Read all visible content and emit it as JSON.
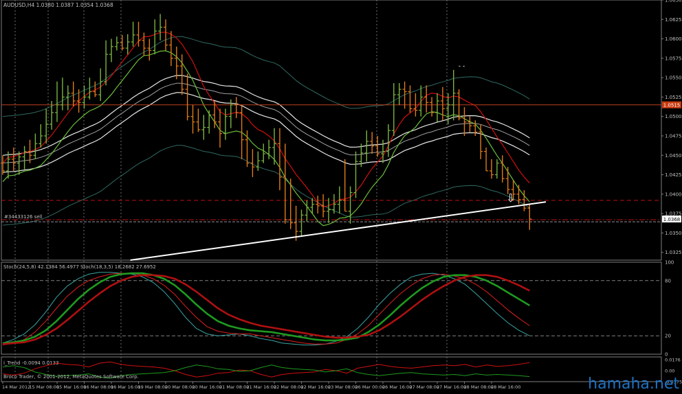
{
  "colors": {
    "background": "#000000",
    "frame": "#808080",
    "grid": "#707070",
    "axis_text": "#c0c0c0",
    "bull": "#7cb342",
    "bear": "#e07a1a",
    "red_ma": "#d01010",
    "green_ma": "#6abf3a",
    "envelope_outer": "#e8e8e8",
    "envelope_inner": "#a0a0a0",
    "outer_band": "#2f6a62",
    "trendline": "#ffffff",
    "level_line": "#c04020",
    "dash_level": "#c01010",
    "bid_line": "#909090",
    "price_tag_bg": "#c83a10",
    "price_tag_text": "#ffffff",
    "watermark": "#1f72c4",
    "stoch_cyan": "#3aa3a3",
    "stoch_green": "#1f9a1f",
    "stoch_red": "#b01010",
    "stoch_lightred": "#e02020",
    "trend_green": "#1f9a1f",
    "trend_red": "#d01010"
  },
  "chart_data": [
    {
      "type": "ohlc",
      "title": "AUDUSD,H4  1.0380 1.0387 1.0354 1.0368",
      "price_axis": {
        "ylim": [
          1.0315,
          1.065
        ],
        "ticks": [
          "1.0650",
          "1.0625",
          "1.0600",
          "1.0575",
          "1.0550",
          "1.0525",
          "1.0500",
          "1.0475",
          "1.0450",
          "1.0425",
          "1.0400",
          "1.0375",
          "1.0350",
          "1.0325"
        ]
      },
      "bars": {
        "open": [
          1.044,
          1.043,
          1.0445,
          1.044,
          1.0448,
          1.0455,
          1.045,
          1.0465,
          1.0475,
          1.049,
          1.0505,
          1.0515,
          1.0525,
          1.053,
          1.052,
          1.0518,
          1.0525,
          1.0532,
          1.0528,
          1.0545,
          1.058,
          1.059,
          1.0595,
          1.0588,
          1.0596,
          1.0605,
          1.0598,
          1.0588,
          1.0585,
          1.061,
          1.0615,
          1.0592,
          1.0575,
          1.0565,
          1.0535,
          1.05,
          1.0493,
          1.0483,
          1.0486,
          1.0502,
          1.0493,
          1.0478,
          1.05,
          1.0515,
          1.0505,
          1.047,
          1.044,
          1.0435,
          1.0443,
          1.0452,
          1.046,
          1.0465,
          1.0422,
          1.0367,
          1.0363,
          1.0352,
          1.0373,
          1.0383,
          1.0387,
          1.0385,
          1.0378,
          1.038,
          1.0387,
          1.0392,
          1.0378,
          1.0402,
          1.0442,
          1.0453,
          1.0468,
          1.0462,
          1.0452,
          1.0455,
          1.0482,
          1.0528,
          1.0535,
          1.0532,
          1.051,
          1.0508,
          1.0525,
          1.0518,
          1.0505,
          1.052,
          1.051,
          1.0515,
          1.053,
          1.0498,
          1.0493,
          1.0488,
          1.048,
          1.0455,
          1.043,
          1.0425,
          1.044,
          1.042,
          1.0406,
          1.04,
          1.0393,
          1.0382
        ],
        "high": [
          1.045,
          1.0455,
          1.046,
          1.0455,
          1.0462,
          1.047,
          1.0478,
          1.049,
          1.051,
          1.052,
          1.0545,
          1.055,
          1.054,
          1.0545,
          1.0535,
          1.054,
          1.055,
          1.0545,
          1.0562,
          1.0598,
          1.06,
          1.0603,
          1.0605,
          1.0606,
          1.0622,
          1.0622,
          1.0608,
          1.06,
          1.0625,
          1.0632,
          1.0625,
          1.061,
          1.059,
          1.058,
          1.0555,
          1.0515,
          1.051,
          1.0502,
          1.0508,
          1.052,
          1.051,
          1.051,
          1.0522,
          1.0525,
          1.0515,
          1.0482,
          1.0458,
          1.0455,
          1.0465,
          1.047,
          1.0485,
          1.0485,
          1.0465,
          1.042,
          1.0385,
          1.038,
          1.0392,
          1.0395,
          1.0398,
          1.04,
          1.0395,
          1.04,
          1.041,
          1.0445,
          1.041,
          1.0455,
          1.0465,
          1.0482,
          1.048,
          1.0475,
          1.047,
          1.049,
          1.0543,
          1.0543,
          1.0545,
          1.054,
          1.053,
          1.054,
          1.054,
          1.0525,
          1.053,
          1.0538,
          1.053,
          1.056,
          1.0535,
          1.0512,
          1.05,
          1.0495,
          1.049,
          1.046,
          1.0445,
          1.0445,
          1.045,
          1.0435,
          1.0418,
          1.0412,
          1.0405,
          1.0387
        ],
        "low": [
          1.0425,
          1.042,
          1.043,
          1.0425,
          1.0432,
          1.044,
          1.0445,
          1.046,
          1.0465,
          1.0483,
          1.0493,
          1.0508,
          1.0508,
          1.0513,
          1.0505,
          1.051,
          1.0522,
          1.0525,
          1.052,
          1.054,
          1.057,
          1.0585,
          1.0585,
          1.058,
          1.059,
          1.059,
          1.0578,
          1.0572,
          1.058,
          1.0598,
          1.0585,
          1.0565,
          1.0548,
          1.0528,
          1.0495,
          1.0478,
          1.048,
          1.047,
          1.0478,
          1.0485,
          1.046,
          1.047,
          1.0485,
          1.0498,
          1.0445,
          1.0435,
          1.0422,
          1.043,
          1.044,
          1.0445,
          1.0438,
          1.0405,
          1.0362,
          1.0355,
          1.034,
          1.0345,
          1.0365,
          1.0375,
          1.0375,
          1.037,
          1.0363,
          1.0375,
          1.0375,
          1.0378,
          1.0362,
          1.0395,
          1.0435,
          1.0442,
          1.0452,
          1.0448,
          1.044,
          1.0448,
          1.0475,
          1.0515,
          1.051,
          1.0505,
          1.05,
          1.05,
          1.0505,
          1.05,
          1.0493,
          1.0495,
          1.049,
          1.0495,
          1.0495,
          1.0475,
          1.048,
          1.0475,
          1.0445,
          1.043,
          1.042,
          1.042,
          1.0415,
          1.04,
          1.0392,
          1.0387,
          1.0378,
          1.0354
        ],
        "close": [
          1.043,
          1.0445,
          1.044,
          1.0448,
          1.0455,
          1.045,
          1.0465,
          1.0475,
          1.049,
          1.0505,
          1.0515,
          1.0525,
          1.053,
          1.052,
          1.0518,
          1.0525,
          1.0532,
          1.0528,
          1.0545,
          1.058,
          1.059,
          1.0595,
          1.0588,
          1.0596,
          1.0605,
          1.0598,
          1.0588,
          1.0585,
          1.061,
          1.0615,
          1.0592,
          1.0575,
          1.0565,
          1.0535,
          1.05,
          1.0493,
          1.0483,
          1.0486,
          1.0502,
          1.0493,
          1.0478,
          1.05,
          1.0515,
          1.0505,
          1.047,
          1.044,
          1.0435,
          1.0443,
          1.0452,
          1.046,
          1.0465,
          1.0422,
          1.0367,
          1.0363,
          1.0352,
          1.0373,
          1.0383,
          1.0387,
          1.0385,
          1.0378,
          1.038,
          1.0387,
          1.0392,
          1.0378,
          1.0402,
          1.0442,
          1.0453,
          1.0468,
          1.0462,
          1.0452,
          1.0455,
          1.0482,
          1.0528,
          1.0535,
          1.0532,
          1.051,
          1.0508,
          1.0525,
          1.0518,
          1.0505,
          1.052,
          1.051,
          1.0515,
          1.053,
          1.0498,
          1.0493,
          1.0488,
          1.048,
          1.0455,
          1.043,
          1.0425,
          1.044,
          1.042,
          1.0406,
          1.04,
          1.0393,
          1.0382,
          1.0368
        ]
      },
      "levels": [
        {
          "label": "1.0515",
          "value": 1.0515,
          "style": "solid",
          "tagged": true
        },
        {
          "label": "#34433126 sell",
          "value": 1.0367,
          "style": "dash-dot"
        },
        {
          "label": "",
          "value": 1.0392,
          "style": "dashed"
        }
      ],
      "bid_tag": "1.0368",
      "trendline": {
        "from_bar": 23.5,
        "from_value": 1.0315,
        "to_bar": 100,
        "to_value": 1.039
      },
      "annotations": {
        "arrow": "⇩",
        "arrow_bar": 93.5,
        "dash_text": "- -"
      },
      "grid": "vertical-dashed"
    },
    {
      "type": "line",
      "title": "Stoch(24,5,8) 42.1384 56.4977  Stoch(18,3,5) 18.2682 27.6952",
      "ylim": [
        0,
        100
      ],
      "ticks": [
        "100",
        "80",
        "20",
        "0"
      ],
      "levels": [
        80,
        20
      ],
      "series": [
        {
          "name": "",
          "values": [
            12,
            16,
            22,
            32,
            46,
            62,
            74,
            82,
            87,
            89,
            89,
            88,
            87,
            84,
            78,
            68,
            55,
            40,
            28,
            22,
            20,
            21,
            22,
            20,
            17,
            15,
            12,
            11,
            10,
            10,
            11,
            14,
            19,
            28,
            40,
            54,
            66,
            76,
            84,
            87,
            88,
            86,
            82,
            76,
            66,
            55,
            44,
            34,
            26,
            20
          ]
        },
        {
          "name": "",
          "values": [
            10,
            12,
            16,
            24,
            36,
            50,
            63,
            73,
            80,
            84,
            87,
            88,
            88,
            86,
            82,
            75,
            65,
            52,
            40,
            30,
            25,
            23,
            22,
            22,
            20,
            18,
            16,
            14,
            12,
            11,
            11,
            12,
            16,
            22,
            31,
            43,
            55,
            66,
            75,
            82,
            86,
            87,
            85,
            82,
            76,
            68,
            58,
            48,
            39,
            31
          ]
        },
        {
          "name": "",
          "values": [
            12,
            13,
            15,
            19,
            26,
            36,
            48,
            60,
            70,
            78,
            84,
            87,
            88,
            88,
            86,
            82,
            75,
            65,
            54,
            44,
            36,
            31,
            28,
            26,
            25,
            24,
            22,
            20,
            18,
            16,
            15,
            15,
            16,
            18,
            24,
            32,
            42,
            53,
            63,
            72,
            79,
            84,
            86,
            86,
            84,
            80,
            74,
            67,
            60,
            53
          ]
        },
        {
          "name": "",
          "values": [
            11,
            12,
            13,
            16,
            21,
            28,
            37,
            47,
            57,
            66,
            74,
            80,
            84,
            86,
            86,
            85,
            82,
            76,
            68,
            59,
            50,
            43,
            38,
            34,
            31,
            29,
            27,
            25,
            23,
            21,
            19,
            18,
            18,
            19,
            21,
            26,
            33,
            41,
            50,
            59,
            67,
            74,
            80,
            84,
            86,
            86,
            84,
            80,
            75,
            69
          ]
        }
      ]
    },
    {
      "type": "line",
      "title": "i_Trend -0.0094 0.0133",
      "ylim": [
        -0.0175,
        0.022
      ],
      "ticks": [
        "0.0176",
        "0.00",
        "-0.0175"
      ],
      "series": [
        {
          "name": "",
          "values": [
            -0.005,
            -0.007,
            -0.004,
            0.003,
            0.008,
            0.012,
            0.01,
            0.009,
            0.006,
            0.012,
            0.014,
            0.01,
            0.008,
            0.007,
            0.006,
            0.004,
            0.0,
            -0.006,
            -0.01,
            -0.008,
            -0.004,
            -0.003,
            0.001,
            0.0,
            -0.006,
            -0.01,
            -0.006,
            -0.004,
            -0.003,
            -0.002,
            0.002,
            0.0,
            -0.004,
            0.004,
            0.007,
            0.01,
            0.007,
            0.005,
            0.004,
            0.006,
            0.008,
            0.009,
            0.008,
            0.01,
            0.006,
            0.009,
            0.007,
            0.008,
            0.01,
            0.013
          ]
        },
        {
          "name": "",
          "values": [
            0.006,
            0.008,
            0.005,
            -0.002,
            -0.006,
            -0.009,
            -0.008,
            -0.007,
            -0.005,
            -0.01,
            -0.012,
            -0.008,
            -0.006,
            -0.005,
            -0.004,
            -0.003,
            0.0,
            0.005,
            0.009,
            0.007,
            0.003,
            0.002,
            -0.001,
            0.0,
            0.005,
            0.009,
            0.005,
            0.003,
            0.002,
            0.001,
            -0.002,
            0.0,
            0.003,
            -0.003,
            -0.006,
            -0.008,
            -0.006,
            -0.004,
            -0.003,
            -0.005,
            -0.006,
            -0.007,
            -0.006,
            -0.008,
            -0.005,
            -0.007,
            -0.006,
            -0.007,
            -0.008,
            -0.0094
          ]
        }
      ]
    }
  ],
  "time_axis": {
    "labels": [
      "14 Mar 2012",
      "15 Mar 08:00",
      "15 Mar 16:00",
      "16 Mar 08:00",
      "16 Mar 16:00",
      "19 Mar 08:00",
      "20 Mar 08:00",
      "20 Mar 16:00",
      "21 Mar 08:00",
      "21 Mar 16:00",
      "22 Mar 08:00",
      "22 Mar 16:00",
      "23 Mar 08:00",
      "26 Mar 00:00",
      "26 Mar 16:00",
      "27 Mar 08:00",
      "27 Mar 16:00",
      "28 Mar 08:00",
      "28 Mar 16:00"
    ],
    "label_bars": [
      0,
      5,
      10,
      15,
      20,
      25,
      30,
      35,
      40,
      45,
      50,
      55,
      60,
      65,
      70,
      75,
      80,
      85,
      90
    ]
  },
  "footer": {
    "copyright": "Broco Trader, © 2001-2012, MetaQuotes Software Corp."
  },
  "watermark": {
    "text": "hamaha.net"
  }
}
